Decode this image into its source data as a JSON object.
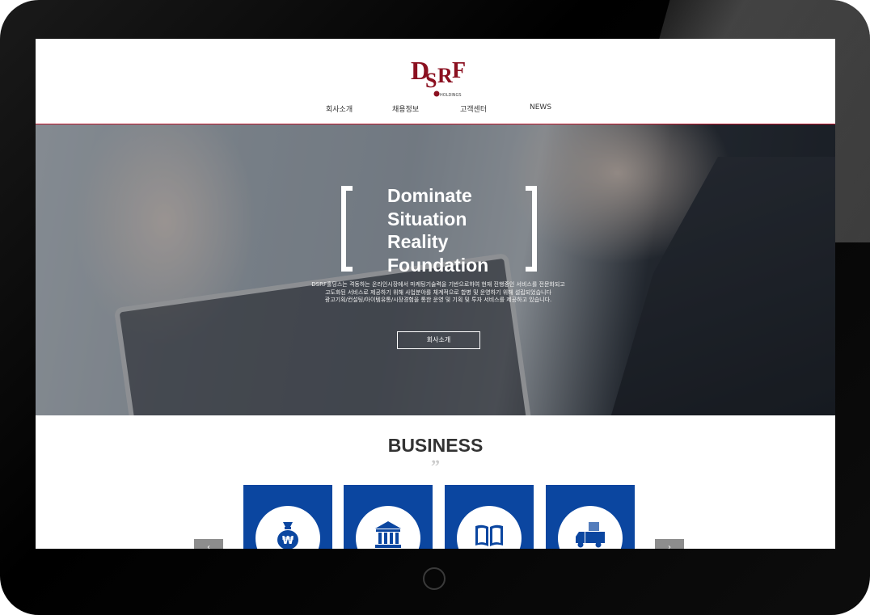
{
  "logo": {
    "letters": "DSRF",
    "sub": "HOLDINGS",
    "icon": "dsrf-logo"
  },
  "nav": [
    {
      "label": "회사소개"
    },
    {
      "label": "채용정보"
    },
    {
      "label": "고객센터"
    },
    {
      "label": "NEWS"
    }
  ],
  "hero": {
    "headline": [
      "Dominate",
      "Situation",
      "Reality",
      "Foundation"
    ],
    "description": [
      "DSRF홀딩스는 격동하는 온라인시장에서 마케팅기술력을 기반으로하여 현재 진행중인 서비스를 전문화되고",
      "고도화된 서비스로 제공하기 위해 사업분야를 체계적으로 합병 및 운영하기 위해 설립되었습니다",
      "광고기획/컨설팅/아이템유통/시장경험을 통한 운영 및 기획 및 투자 서비스를 제공하고 있습니다."
    ],
    "button_label": "회사소개"
  },
  "business": {
    "title": "BUSINESS",
    "quote_mark": "”",
    "cards": [
      {
        "icon": "money-bag-icon"
      },
      {
        "icon": "bank-icon"
      },
      {
        "icon": "book-icon"
      },
      {
        "icon": "delivery-truck-icon"
      }
    ],
    "prev_arrow": "‹",
    "next_arrow": "›"
  },
  "colors": {
    "brand_red": "#8b1020",
    "accent_line": "#b8142a",
    "card_blue": "#0b46a0",
    "arrow_gray": "#8d8d8d"
  }
}
